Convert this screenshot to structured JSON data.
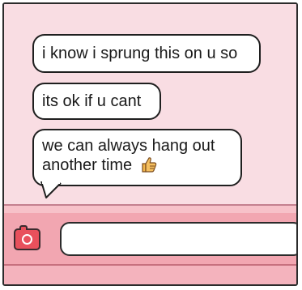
{
  "messages": [
    {
      "text": "i know i sprung this on u so"
    },
    {
      "text": "its ok if u cant"
    },
    {
      "text": "we can always hang out another time",
      "emoji": "thumbs-up-icon"
    }
  ],
  "composer": {
    "value": "",
    "camera_icon": "camera-icon"
  },
  "colors": {
    "chat_background": "#f9dde3",
    "input_bar": "#f2a6b1",
    "camera_button": "#e8505c",
    "bubble": "#ffffff",
    "outline": "#1f1f1f"
  }
}
